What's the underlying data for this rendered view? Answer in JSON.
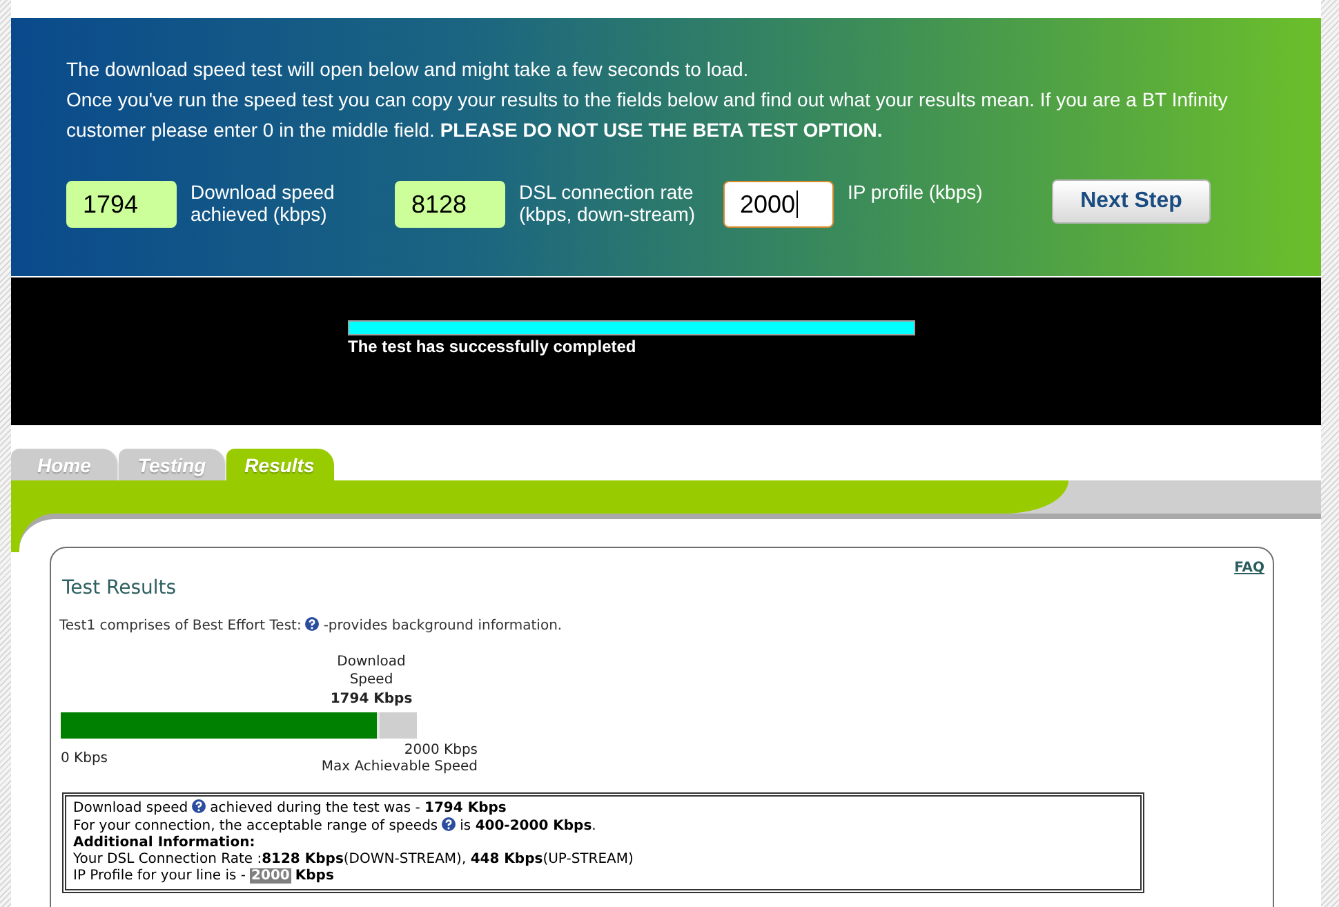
{
  "intro": {
    "line_1": "The download speed test will open below and might take a few seconds to load.",
    "paragraph": "Once you've run the speed test you can copy your results to the fields below and find out what your results mean. If you are a BT Infinity customer please enter 0 in the middle field. **PLEASE DO NOT USE THE BETA TEST OPTION.**"
  },
  "fields": [
    {
      "value": "1794",
      "label": "Download speed achieved (kbps)",
      "focused": false
    },
    {
      "value": "8128",
      "label": "DSL connection rate (kbps, down-stream)",
      "focused": false
    },
    {
      "value": "2000",
      "label": "IP profile (kbps)",
      "focused": true
    }
  ],
  "next_button": "Next Step",
  "speed_test": {
    "level": 1,
    "status": "The test has successfully completed"
  },
  "tabs": [
    {
      "label": "Home",
      "selected": false
    },
    {
      "label": "Testing",
      "selected": false
    },
    {
      "label": "Results",
      "selected": true
    }
  ],
  "results": {
    "faq_link": "FAQ",
    "title": "Test Results",
    "description": [
      {
        "kind": "text",
        "text": "Test1 comprises of Best Effort Test:"
      },
      {
        "kind": "help"
      },
      {
        "kind": "text",
        "text": "-provides background information."
      }
    ],
    "meter": {
      "label": "Download Speed",
      "reading": "1794 Kbps",
      "level": 0.897,
      "min_label": "0 Kbps",
      "max_label": "2000 Kbps",
      "max_caption": "Max Achievable Speed"
    },
    "details": [
      [
        {
          "kind": "text",
          "text": "Download speed"
        },
        {
          "kind": "help"
        },
        {
          "kind": "text",
          "text": "achieved during the test was - **1794 Kbps**"
        }
      ],
      [
        {
          "kind": "text",
          "text": "For your connection, the acceptable range of speeds"
        },
        {
          "kind": "help"
        },
        {
          "kind": "text",
          "text": "is **400-2000 Kbps**."
        }
      ],
      [
        {
          "kind": "bold",
          "text": "Additional Information:"
        }
      ],
      [
        {
          "kind": "text",
          "text": "Your DSL Connection Rate :**8128 Kbps**(DOWN-STREAM), **448 Kbps**(UP-STREAM)"
        }
      ],
      [
        {
          "kind": "text",
          "text": "IP Profile for your line is -"
        },
        {
          "kind": "highlight",
          "text": "2000"
        },
        {
          "kind": "bold",
          "text": "Kbps"
        }
      ]
    ]
  }
}
